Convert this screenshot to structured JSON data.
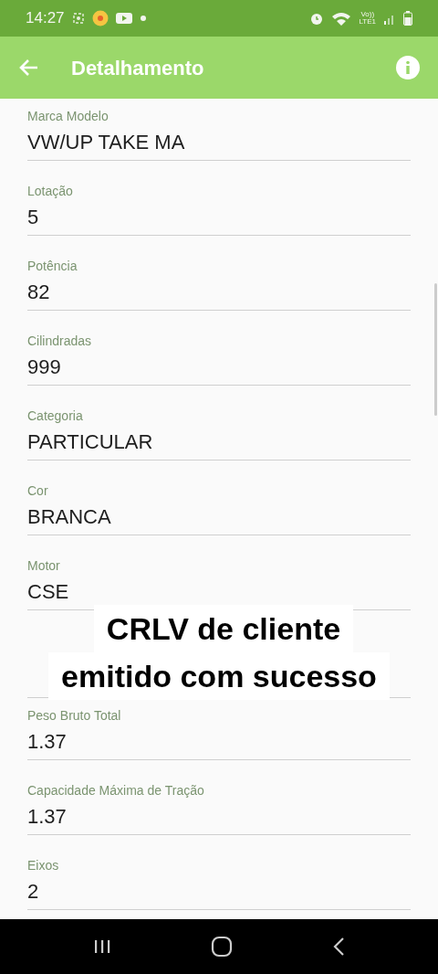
{
  "status_bar": {
    "time": "14:27",
    "network_top": "Vo))",
    "network_bottom": "LTE1"
  },
  "app_bar": {
    "title": "Detalhamento"
  },
  "fields": [
    {
      "label": "Marca Modelo",
      "value": "VW/UP TAKE MA"
    },
    {
      "label": "Lotação",
      "value": "5"
    },
    {
      "label": "Potência",
      "value": "82"
    },
    {
      "label": "Cilindradas",
      "value": "999"
    },
    {
      "label": "Categoria",
      "value": "PARTICULAR"
    },
    {
      "label": "Cor",
      "value": "BRANCA"
    },
    {
      "label": "Motor",
      "value": "CSE"
    },
    {
      "label": "Peso Bruto Total",
      "value": "1.37"
    },
    {
      "label": "Capacidade Máxima de Tração",
      "value": "1.37"
    },
    {
      "label": "Eixos",
      "value": "2"
    }
  ],
  "caption": {
    "lines": [
      "CRLV de cliente",
      "emitido com sucesso"
    ]
  }
}
